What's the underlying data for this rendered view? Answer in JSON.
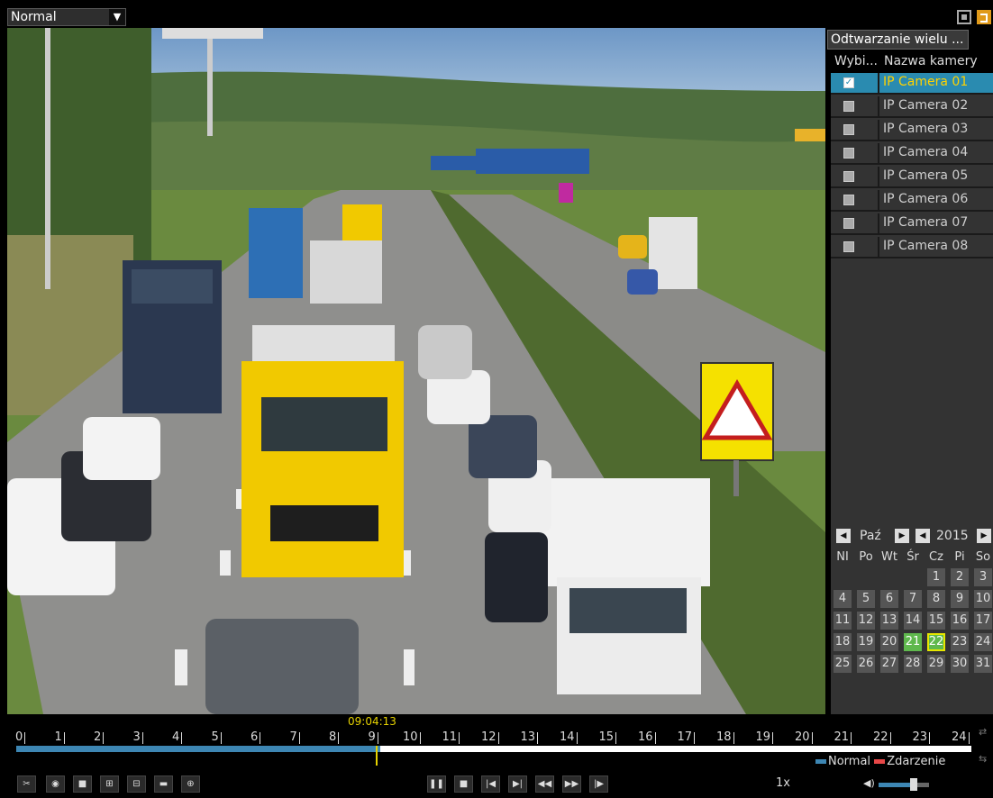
{
  "top": {
    "mode": "Normal"
  },
  "side": {
    "multi_button": "Odtwarzanie wielu ...",
    "col_select": "Wybi...",
    "col_name": "Nazwa kamery",
    "cameras": [
      {
        "name": "IP Camera 01",
        "checked": true
      },
      {
        "name": "IP Camera 02",
        "checked": false
      },
      {
        "name": "IP Camera 03",
        "checked": false
      },
      {
        "name": "IP Camera 04",
        "checked": false
      },
      {
        "name": "IP Camera 05",
        "checked": false
      },
      {
        "name": "IP Camera 06",
        "checked": false
      },
      {
        "name": "IP Camera 07",
        "checked": false
      },
      {
        "name": "IP Camera 08",
        "checked": false
      }
    ]
  },
  "calendar": {
    "month": "Paź",
    "year": "2015",
    "weekdays": [
      "NI",
      "Po",
      "Wt",
      "Śr",
      "Cz",
      "Pi",
      "So"
    ],
    "first_weekday": 4,
    "days_in_month": 31,
    "recorded_days": [
      21,
      22
    ],
    "selected_day": 22
  },
  "timeline": {
    "current_time": "09:04:13",
    "hours": [
      "0",
      "1",
      "2",
      "3",
      "4",
      "5",
      "6",
      "7",
      "8",
      "9",
      "10",
      "11",
      "12",
      "13",
      "14",
      "15",
      "16",
      "17",
      "18",
      "19",
      "20",
      "21",
      "22",
      "23",
      "24"
    ],
    "legend_normal": "Normal",
    "legend_event": "Zdarzenie",
    "normal_color": "#3d86b3",
    "event_color": "#e84848"
  },
  "controls": {
    "speed": "1x",
    "volume_fraction": 0.7
  }
}
